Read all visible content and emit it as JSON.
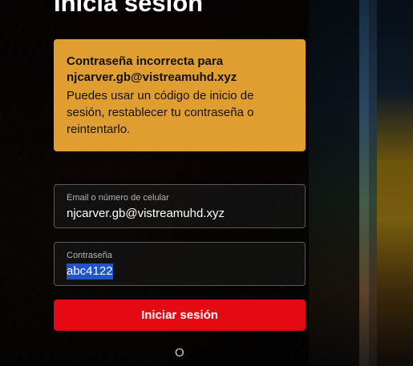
{
  "page": {
    "title": "Inicia sesión"
  },
  "alert": {
    "title": "Contraseña incorrecta para njcarver.gb@vistreamuhd.xyz",
    "body": "Puedes usar un código de inicio de sesión, restablecer tu contraseña o reintentarlo.",
    "color": "#e09e30"
  },
  "email_field": {
    "label": "Email o número de celular",
    "value": "njcarver.gb@vistreamuhd.xyz"
  },
  "password_field": {
    "label": "Contraseña",
    "value": "abc4122",
    "selected": true
  },
  "signin_button": {
    "label": "Iniciar sesión",
    "color": "#e50914"
  },
  "divider": {
    "text": "O"
  }
}
